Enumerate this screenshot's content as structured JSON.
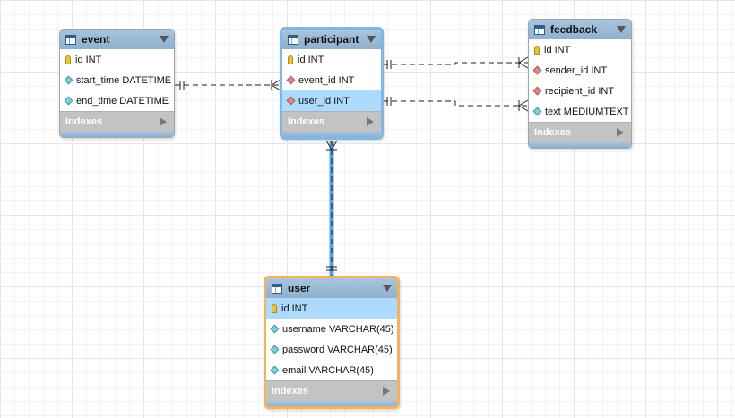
{
  "tables": {
    "event": {
      "title": "event",
      "columns": [
        {
          "label": "id INT",
          "key": "pk"
        },
        {
          "label": "start_time DATETIME",
          "key": "col"
        },
        {
          "label": "end_time DATETIME",
          "key": "col"
        }
      ],
      "indexes_label": "Indexes"
    },
    "participant": {
      "title": "participant",
      "columns": [
        {
          "label": "id INT",
          "key": "pk"
        },
        {
          "label": "event_id INT",
          "key": "fk"
        },
        {
          "label": "user_id INT",
          "key": "fk",
          "highlighted": true
        }
      ],
      "indexes_label": "Indexes"
    },
    "feedback": {
      "title": "feedback",
      "columns": [
        {
          "label": "id INT",
          "key": "pk"
        },
        {
          "label": "sender_id INT",
          "key": "fk"
        },
        {
          "label": "recipient_id INT",
          "key": "fk"
        },
        {
          "label": "text MEDIUMTEXT",
          "key": "col"
        }
      ],
      "indexes_label": "Indexes"
    },
    "user": {
      "title": "user",
      "columns": [
        {
          "label": "id INT",
          "key": "pk",
          "highlighted": true
        },
        {
          "label": "username VARCHAR(45)",
          "key": "col"
        },
        {
          "label": "password VARCHAR(45)",
          "key": "col"
        },
        {
          "label": "email VARCHAR(45)",
          "key": "col"
        }
      ],
      "indexes_label": "Indexes"
    }
  },
  "colors": {
    "header": "#8fb0cf",
    "selected_blue": "#7fb7e8",
    "selected_orange": "#f3b35a",
    "highlight_row": "#aedbfd",
    "indexes_bar": "#c3c3c3"
  }
}
